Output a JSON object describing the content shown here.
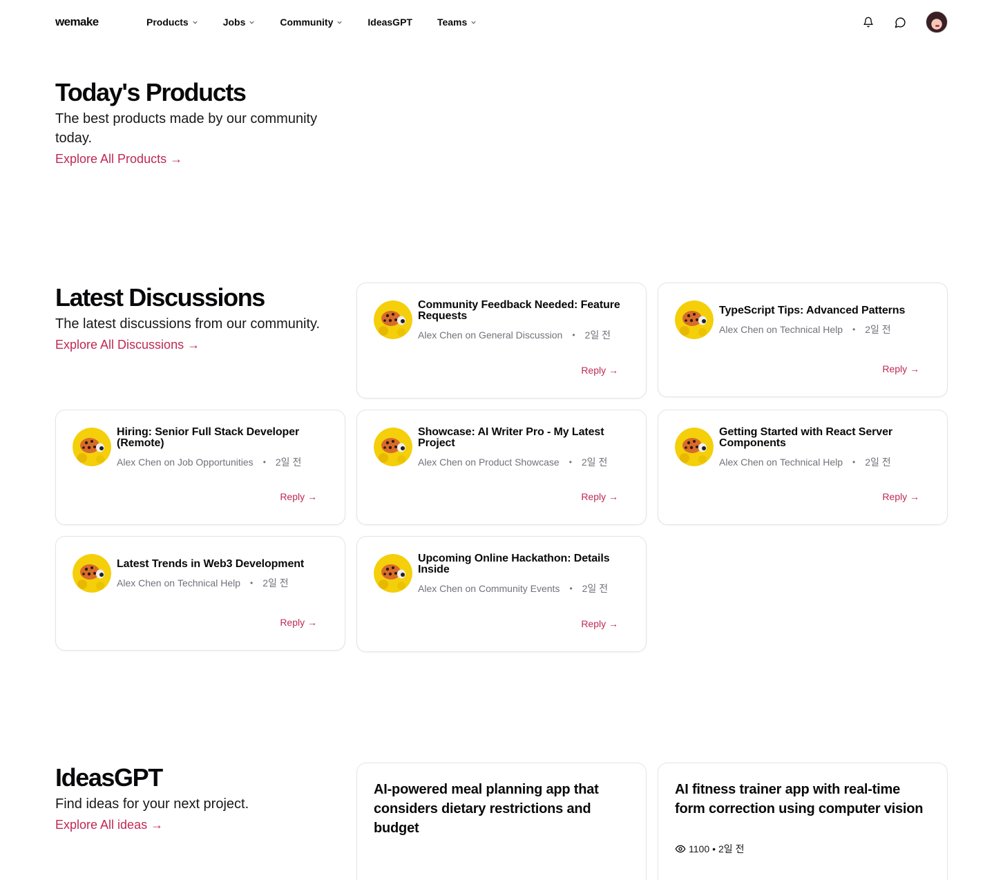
{
  "nav": {
    "logo": "wemake",
    "menu": [
      {
        "label": "Products",
        "has_dropdown": true
      },
      {
        "label": "Jobs",
        "has_dropdown": true
      },
      {
        "label": "Community",
        "has_dropdown": true
      },
      {
        "label": "IdeasGPT",
        "has_dropdown": false
      },
      {
        "label": "Teams",
        "has_dropdown": true
      }
    ],
    "icons": [
      "bell-icon",
      "message-circle-icon",
      "user-avatar"
    ]
  },
  "products": {
    "title": "Today's Products",
    "subtitle": "The best products made by our community today.",
    "link": "Explore All Products →"
  },
  "discussions": {
    "title": "Latest Discussions",
    "subtitle": "The latest discussions from our community.",
    "link": "Explore All Discussions →",
    "items": [
      {
        "title": "Community Feedback Needed: Feature Requests",
        "author": "Alex Chen",
        "on": "on",
        "category": "General Discussion",
        "time": "2일 전",
        "reply": "Reply →"
      },
      {
        "title": "TypeScript Tips: Advanced Patterns",
        "author": "Alex Chen",
        "on": "on",
        "category": "Technical Help",
        "time": "2일 전",
        "reply": "Reply →"
      },
      {
        "title": "Hiring: Senior Full Stack Developer (Remote)",
        "author": "Alex Chen",
        "on": "on",
        "category": "Job Opportunities",
        "time": "2일 전",
        "reply": "Reply →"
      },
      {
        "title": "Showcase: AI Writer Pro - My Latest Project",
        "author": "Alex Chen",
        "on": "on",
        "category": "Product Showcase",
        "time": "2일 전",
        "reply": "Reply →"
      },
      {
        "title": "Getting Started with React Server Components",
        "author": "Alex Chen",
        "on": "on",
        "category": "Technical Help",
        "time": "2일 전",
        "reply": "Reply →"
      },
      {
        "title": "Latest Trends in Web3 Development",
        "author": "Alex Chen",
        "on": "on",
        "category": "Technical Help",
        "time": "2일 전",
        "reply": "Reply →"
      },
      {
        "title": "Upcoming Online Hackathon: Details Inside",
        "author": "Alex Chen",
        "on": "on",
        "category": "Community Events",
        "time": "2일 전",
        "reply": "Reply →"
      }
    ]
  },
  "ideas": {
    "title": "IdeasGPT",
    "subtitle": "Find ideas for your next project.",
    "link": "Explore All ideas →",
    "items": [
      {
        "text": "AI-powered meal planning app that considers dietary restrictions and budget",
        "views": "",
        "time": ""
      },
      {
        "text": "AI fitness trainer app with real-time form correction using computer vision",
        "views": "1100",
        "time": "2일 전"
      }
    ]
  },
  "colors": {
    "accent": "#be2953",
    "muted": "#71717a",
    "border": "#e4e4e7"
  }
}
